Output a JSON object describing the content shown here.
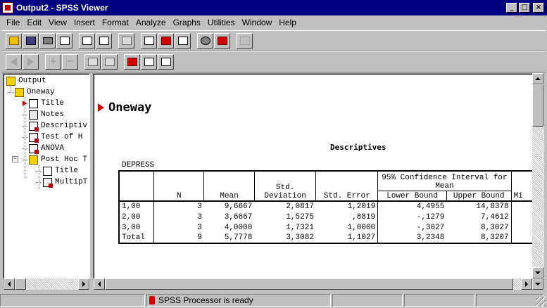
{
  "window": {
    "title": "Output2 - SPSS Viewer"
  },
  "window_controls": {
    "minimize": "_",
    "maximize": "□",
    "close": "×"
  },
  "menu": [
    "File",
    "Edit",
    "View",
    "Insert",
    "Format",
    "Analyze",
    "Graphs",
    "Utilities",
    "Window",
    "Help"
  ],
  "toolbar1": [
    {
      "name": "open-icon",
      "glyph": "folder",
      "disabled": false
    },
    {
      "name": "save-icon",
      "glyph": "disk",
      "disabled": false
    },
    {
      "name": "print-icon",
      "glyph": "printer",
      "disabled": false
    },
    {
      "name": "print-preview-icon",
      "glyph": "page",
      "disabled": false
    },
    {
      "name": "export-icon",
      "glyph": "page",
      "disabled": false
    },
    {
      "name": "dialog-recall-icon",
      "glyph": "page",
      "disabled": false
    },
    {
      "name": "undo-icon",
      "glyph": "page",
      "disabled": true
    },
    {
      "name": "goto-data-icon",
      "glyph": "page",
      "disabled": false
    },
    {
      "name": "goto-case-icon",
      "glyph": "red",
      "disabled": false
    },
    {
      "name": "variables-icon",
      "glyph": "page",
      "disabled": false
    },
    {
      "name": "select-cases-icon",
      "glyph": "circle",
      "disabled": false
    },
    {
      "name": "designate-window-icon",
      "glyph": "red",
      "disabled": false
    },
    {
      "name": "run-icon",
      "glyph": "excl",
      "disabled": true
    }
  ],
  "toolbar2": [
    {
      "name": "promote-icon",
      "glyph": "arrow-l",
      "disabled": true
    },
    {
      "name": "demote-icon",
      "glyph": "arrow-r",
      "disabled": true
    },
    {
      "name": "expand-icon",
      "glyph": "plus",
      "disabled": true
    },
    {
      "name": "collapse-icon",
      "glyph": "minus",
      "disabled": true
    },
    {
      "name": "show-icon",
      "glyph": "page",
      "disabled": true
    },
    {
      "name": "hide-icon",
      "glyph": "page",
      "disabled": true
    },
    {
      "name": "insert-heading-icon",
      "glyph": "red",
      "disabled": false
    },
    {
      "name": "insert-title-icon",
      "glyph": "page",
      "disabled": false
    },
    {
      "name": "insert-text-icon",
      "glyph": "page",
      "disabled": false
    }
  ],
  "outline": {
    "items": [
      {
        "label": "Output",
        "icon": "book",
        "level": 0
      },
      {
        "label": "Oneway",
        "icon": "book",
        "level": 1
      },
      {
        "label": "Title",
        "icon": "page",
        "level": 2,
        "selected": true
      },
      {
        "label": "Notes",
        "icon": "notes",
        "level": 2
      },
      {
        "label": "Descriptiv",
        "icon": "table",
        "level": 2
      },
      {
        "label": "Test of H",
        "icon": "table",
        "level": 2
      },
      {
        "label": "ANOVA",
        "icon": "table",
        "level": 2
      },
      {
        "label": "Post Hoc T",
        "icon": "book",
        "level": 2,
        "expander": "−"
      },
      {
        "label": "Title",
        "icon": "page",
        "level": 3
      },
      {
        "label": "MultipT",
        "icon": "table",
        "level": 3
      }
    ]
  },
  "content": {
    "heading": "Oneway",
    "table_title": "Descriptives",
    "variable": "DEPRESS",
    "headers": {
      "n": "N",
      "mean": "Mean",
      "std_dev": "Std. Deviation",
      "std_error": "Std. Error",
      "ci": "95% Confidence Interval for Mean",
      "lower": "Lower Bound",
      "upper": "Upper Bound",
      "min": "Mi"
    },
    "rows": [
      {
        "label": "1,00",
        "n": "3",
        "mean": "9,6667",
        "sd": "2,0817",
        "se": "1,2019",
        "lower": "4,4955",
        "upper": "14,8378"
      },
      {
        "label": "2,00",
        "n": "3",
        "mean": "3,6667",
        "sd": "1,5275",
        "se": ",8819",
        "lower": "-,1279",
        "upper": "7,4612"
      },
      {
        "label": "3,00",
        "n": "3",
        "mean": "4,0000",
        "sd": "1,7321",
        "se": "1,0000",
        "lower": "-,3027",
        "upper": "8,3027"
      },
      {
        "label": "Total",
        "n": "9",
        "mean": "5,7778",
        "sd": "3,3082",
        "se": "1,1027",
        "lower": "3,2348",
        "upper": "8,3207"
      }
    ]
  },
  "status": {
    "processor": "SPSS Processor  is ready"
  }
}
